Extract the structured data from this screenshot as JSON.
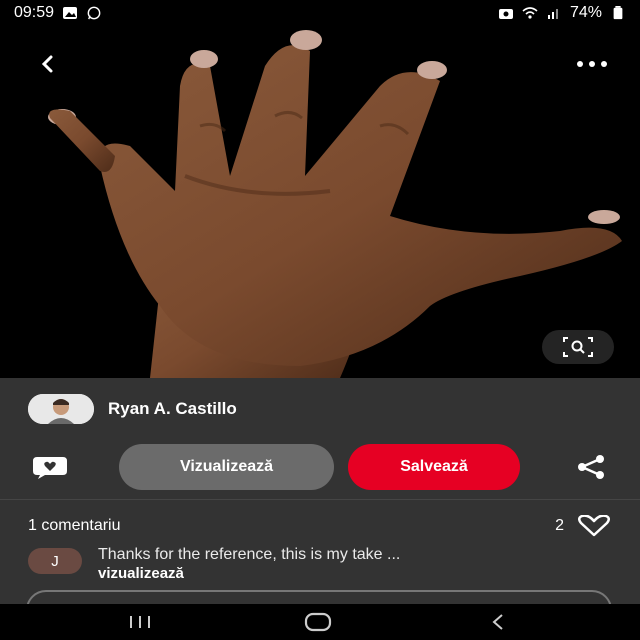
{
  "status_bar": {
    "time": "09:59",
    "battery": "74%",
    "icons_left": [
      "gallery-icon",
      "whatsapp-icon"
    ],
    "icons_right": [
      "camera-icon",
      "wifi-icon",
      "signal-icon",
      "battery-icon"
    ]
  },
  "pin": {
    "image_subject": "hand-photo",
    "author": {
      "name": "Ryan A. Castillo"
    }
  },
  "actions": {
    "view_label": "Vizualizează",
    "save_label": "Salvează",
    "save_color": "#e60023"
  },
  "comments": {
    "count_label": "1 comentariu",
    "likes": "2",
    "items": [
      {
        "avatar_initial": "J",
        "text": "Thanks for the reference, this is my take ...",
        "more_label": "vizualizează"
      }
    ]
  },
  "colors": {
    "panel_bg": "#333333",
    "view_button": "#6b6b6b"
  }
}
